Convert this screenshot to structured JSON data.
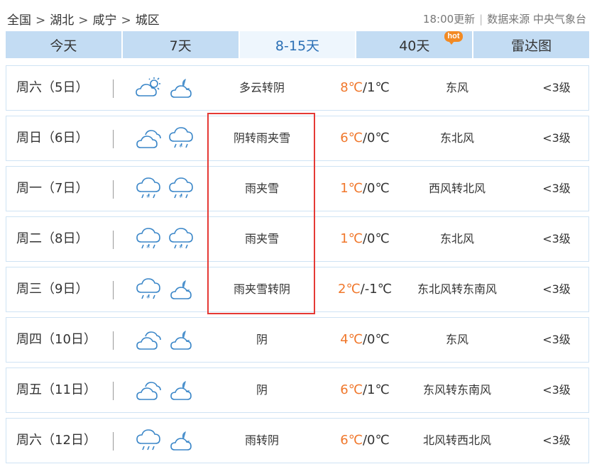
{
  "breadcrumb": {
    "items": [
      "全国",
      "湖北",
      "咸宁",
      "城区"
    ],
    "separator": ">"
  },
  "source": {
    "update_time": "18:00更新",
    "label": "数据来源 中央气象台"
  },
  "tabs": [
    {
      "label": "今天"
    },
    {
      "label": "7天"
    },
    {
      "label": "8-15天",
      "active": true
    },
    {
      "label": "40天",
      "badge": "hot"
    },
    {
      "label": "雷达图"
    }
  ],
  "days": [
    {
      "day": "周六（5日）",
      "icons": [
        "partly-cloudy-sun-icon",
        "cloudy-moon-icon"
      ],
      "desc": "多云转阴",
      "hi": "8℃",
      "lo": "/1℃",
      "wind": "东风",
      "level": "<3级"
    },
    {
      "day": "周日（6日）",
      "icons": [
        "overcast-cloud-icon",
        "sleet-icon"
      ],
      "desc": "阴转雨夹雪",
      "hi": "6℃",
      "lo": "/0℃",
      "wind": "东北风",
      "level": "<3级"
    },
    {
      "day": "周一（7日）",
      "icons": [
        "sleet-icon",
        "sleet-icon"
      ],
      "desc": "雨夹雪",
      "hi": "1℃",
      "lo": "/0℃",
      "wind": "西风转北风",
      "level": "<3级"
    },
    {
      "day": "周二（8日）",
      "icons": [
        "sleet-icon",
        "sleet-icon"
      ],
      "desc": "雨夹雪",
      "hi": "1℃",
      "lo": "/0℃",
      "wind": "东北风",
      "level": "<3级"
    },
    {
      "day": "周三（9日）",
      "icons": [
        "sleet-icon",
        "cloudy-moon-icon"
      ],
      "desc": "雨夹雪转阴",
      "hi": "2℃",
      "lo": "/-1℃",
      "wind": "东北风转东南风",
      "level": "<3级"
    },
    {
      "day": "周四（10日）",
      "icons": [
        "overcast-cloud-icon",
        "cloudy-moon-icon"
      ],
      "desc": "阴",
      "hi": "4℃",
      "lo": "/0℃",
      "wind": "东风",
      "level": "<3级"
    },
    {
      "day": "周五（11日）",
      "icons": [
        "overcast-cloud-icon",
        "cloudy-moon-icon"
      ],
      "desc": "阴",
      "hi": "6℃",
      "lo": "/1℃",
      "wind": "东风转东南风",
      "level": "<3级"
    },
    {
      "day": "周六（12日）",
      "icons": [
        "rain-icon",
        "cloudy-moon-icon"
      ],
      "desc": "雨转阴",
      "hi": "6℃",
      "lo": "/0℃",
      "wind": "北风转西北风",
      "level": "<3级"
    }
  ],
  "colors": {
    "tab_bg": "#c3dcf3",
    "tab_active_bg": "#eef6fd",
    "tab_active_text": "#2a6fb5",
    "row_border": "#cfe3f4",
    "high_temp": "#f0772b",
    "icon_stroke": "#3a86c8",
    "highlight_box": "#e53935",
    "hot_badge": "#f28a24"
  }
}
